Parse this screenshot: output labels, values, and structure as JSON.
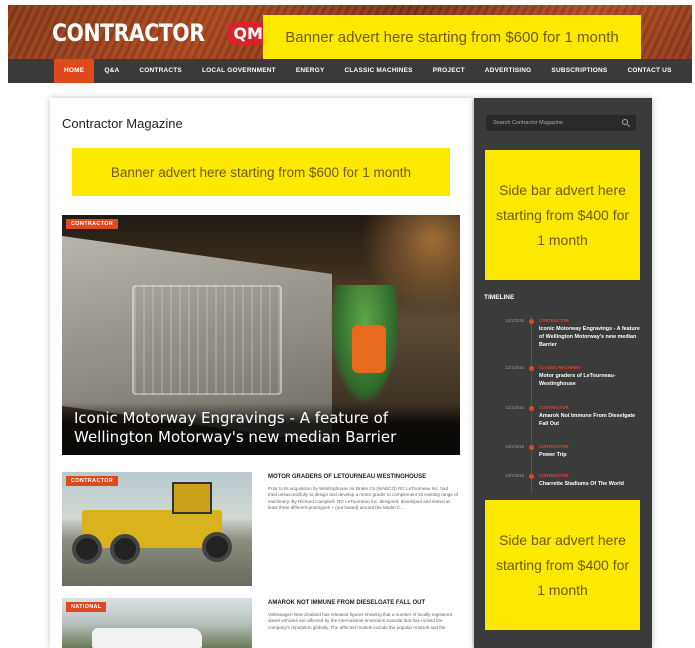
{
  "header": {
    "logo_text": "CONTRACTOR",
    "logo_badge": "QM",
    "banner_text": "Banner advert here starting from $600 for 1 month"
  },
  "nav": {
    "items": [
      "HOME",
      "Q&A",
      "CONTRACTS",
      "LOCAL GOVERNMENT",
      "ENERGY",
      "CLASSIC MACHINES",
      "PROJECT",
      "ADVERTISING",
      "SUBSCRIPTIONS",
      "CONTACT US"
    ],
    "active": "HOME"
  },
  "main": {
    "title": "Contractor Magazine",
    "banner_text": "Banner advert here starting from $600 for 1 month",
    "hero": {
      "category": "CONTRACTOR",
      "caption": "Iconic Motorway Engravings - A feature of Wellington Motorway's new median Barrier"
    },
    "articles": [
      {
        "category": "CONTRACTOR",
        "title": "MOTOR GRADERS OF LETOURNEAU WESTINGHOUSE",
        "excerpt": "Prior to its acquisition by Westinghouse Air Brake Co (WABCO) RG LeTourneau Inc. had tried unsuccessfully to design and develop a motor grader to complement its existing range of machinery. By Richard Campbell. RG LeTourneau Inc. designed, developed and tested at least three different prototypes + (out based) around the Model C..."
      },
      {
        "category": "NATIONAL",
        "title": "AMAROK NOT IMMUNE FROM DIESELGATE FALL OUT",
        "excerpt": "Volkswagen New Zealand has released figures showing that a number of locally registered diesel vehicles are affected by the international emissions scandal that has rocked the company's reputation globally. The affected models include the popular Amarok and the"
      }
    ]
  },
  "sidebar": {
    "search_placeholder": "Search Contractor Magazine",
    "ad_text": "Side bar advert here starting from $400 for 1 month",
    "ad_text_2": "Side bar advert here starting from $400 for 1 month",
    "timeline_heading": "TIMELINE",
    "timeline": [
      {
        "date": "12/1/2016",
        "category": "CONTRACTOR",
        "title": "Iconic Motorway Engravings - A feature of Wellington Motorway's new median Barrier"
      },
      {
        "date": "12/1/2016",
        "category": "CLASSIC MACHINES",
        "title": "Motor graders of LeTourneau-Westinghouse"
      },
      {
        "date": "11/1/2016",
        "category": "CONTRACTOR",
        "title": "Amarok Not Immune From Dieselgate Fall Out"
      },
      {
        "date": "10/1/2016",
        "category": "CONTRACTOR",
        "title": "Power Trip"
      },
      {
        "date": "10/1/2016",
        "category": "CONTRACTOR",
        "title": "Charrette Stadiums Of The World"
      }
    ]
  },
  "colors": {
    "accent": "#e0491d",
    "ad_yellow": "#fde900",
    "nav_bg": "#3a3a3a",
    "sidebar_bg": "#3b3b3b"
  }
}
